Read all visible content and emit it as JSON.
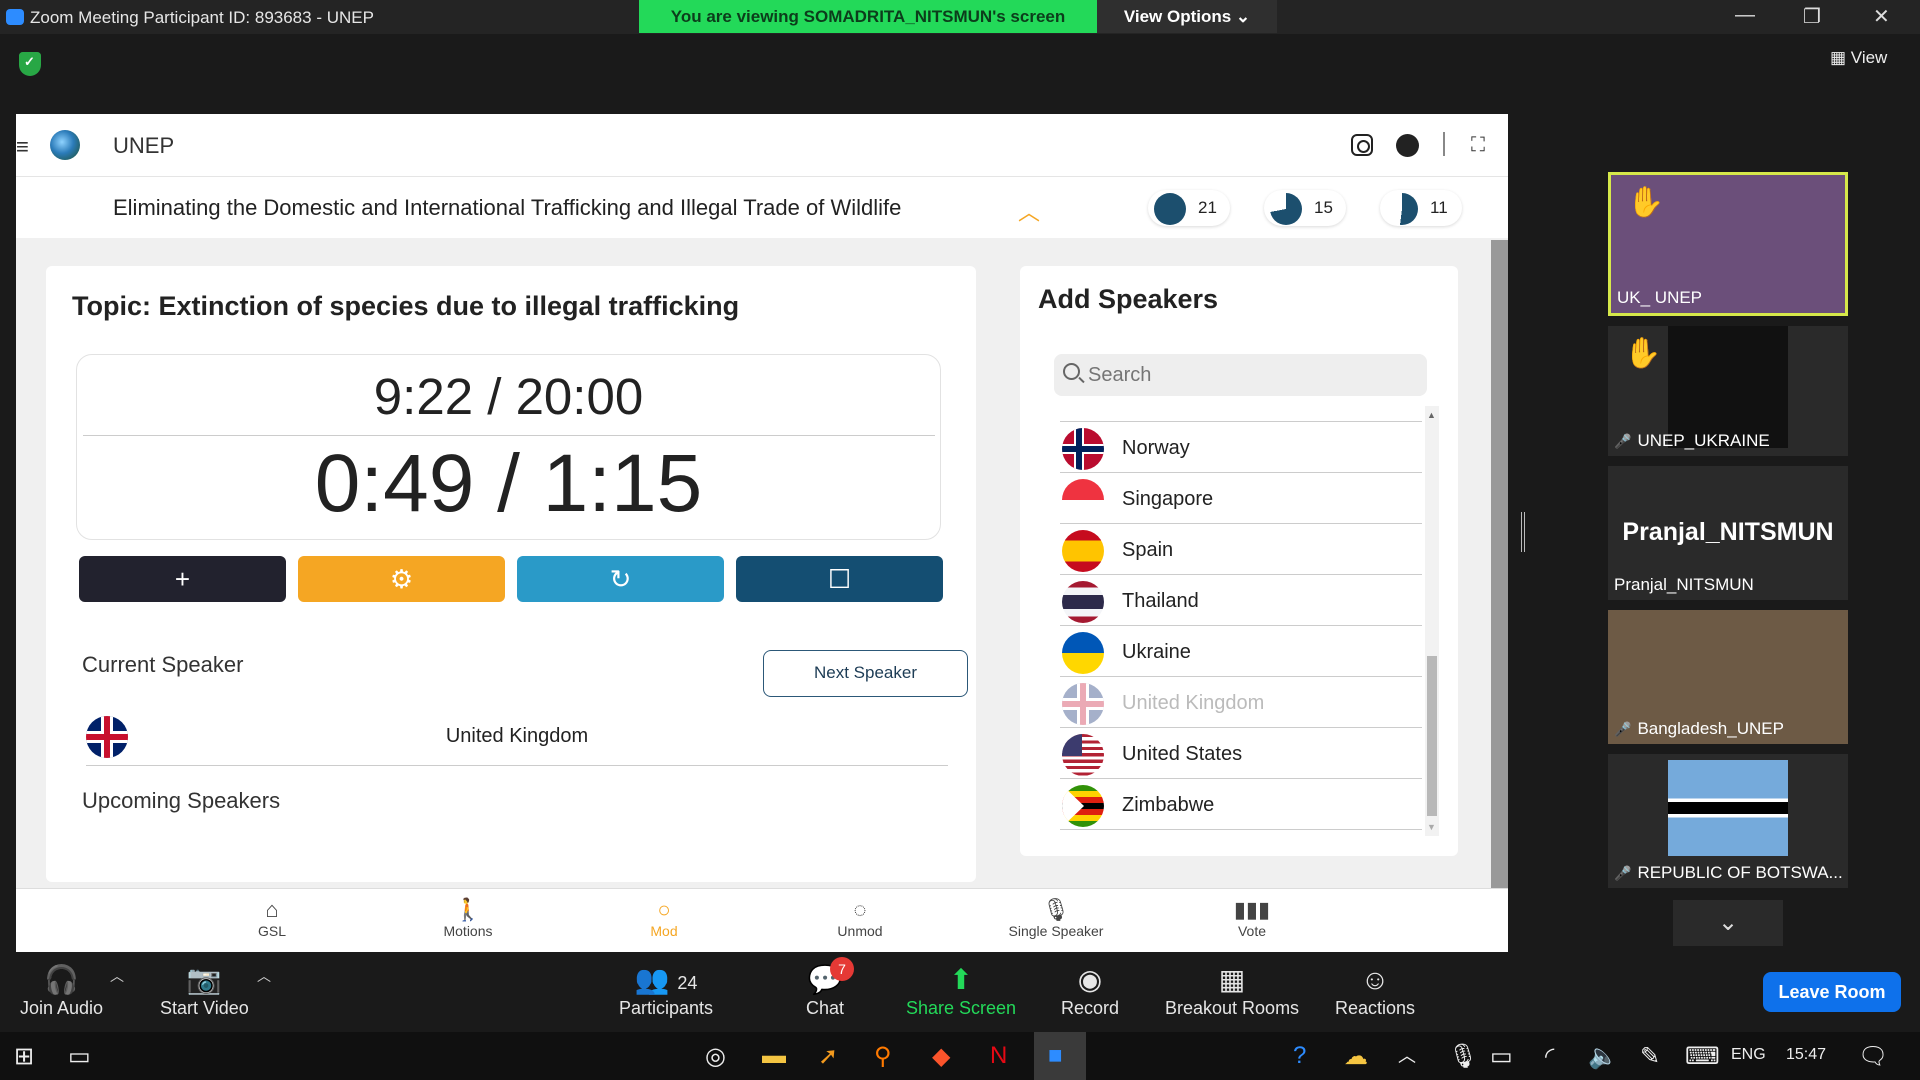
{
  "window": {
    "title": "Zoom Meeting Participant ID: 893683 - UNEP",
    "viewing_banner": "You are viewing SOMADRITA_NITSMUN's screen",
    "view_options": "View Options ⌄",
    "view_label": "View"
  },
  "app": {
    "name": "UNEP",
    "agenda": "Eliminating the Domestic and International Trafficking and Illegal Trade of Wildlife",
    "votes": [
      {
        "count": "21",
        "fraction": 1.0
      },
      {
        "count": "15",
        "fraction": 0.72
      },
      {
        "count": "11",
        "fraction": 0.52
      }
    ]
  },
  "speaker_panel": {
    "topic": "Topic: Extinction of species due to illegal trafficking",
    "total_timer": "9:22 / 20:00",
    "speaker_timer": "0:49 / 1:15",
    "buttons": [
      "+",
      "⚙",
      "↻",
      "☐"
    ],
    "current_speaker_label": "Current Speaker",
    "next_speaker_label": "Next Speaker",
    "current_speaker": "United Kingdom",
    "upcoming_label": "Upcoming Speakers"
  },
  "add_speakers": {
    "heading": "Add Speakers",
    "search_placeholder": "Search",
    "countries": [
      {
        "name": "Norway",
        "disabled": false
      },
      {
        "name": "Singapore",
        "disabled": false
      },
      {
        "name": "Spain",
        "disabled": false
      },
      {
        "name": "Thailand",
        "disabled": false
      },
      {
        "name": "Ukraine",
        "disabled": false
      },
      {
        "name": "United Kingdom",
        "disabled": true
      },
      {
        "name": "United States",
        "disabled": false
      },
      {
        "name": "Zimbabwe",
        "disabled": false
      }
    ]
  },
  "bottom_nav": [
    {
      "label": "GSL",
      "icon": "home-icon"
    },
    {
      "label": "Motions",
      "icon": "walk-icon"
    },
    {
      "label": "Mod",
      "icon": "chat-bubble-icon",
      "active": true
    },
    {
      "label": "Unmod",
      "icon": "chat-bubble-outline-icon"
    },
    {
      "label": "Single Speaker",
      "icon": "microphone-icon"
    },
    {
      "label": "Vote",
      "icon": "bar-chart-icon"
    }
  ],
  "gallery": {
    "tiles": [
      {
        "name": "UK_ UNEP"
      },
      {
        "name": "UNEP_UKRAINE"
      },
      {
        "name": "Pranjal_NITSMUN",
        "display": "Pranjal_NITSMUN"
      },
      {
        "name": "Bangladesh_UNEP"
      },
      {
        "name": "REPUBLIC OF BOTSWA..."
      }
    ]
  },
  "toolbar": {
    "join_audio": "Join Audio",
    "start_video": "Start Video",
    "participants": "Participants",
    "participants_count": "24",
    "chat": "Chat",
    "chat_badge": "7",
    "share_screen": "Share Screen",
    "record": "Record",
    "breakout": "Breakout Rooms",
    "reactions": "Reactions",
    "leave": "Leave Room"
  },
  "taskbar": {
    "lang": "ENG",
    "time": "15:47"
  },
  "colors": {
    "dark_btn": "#22222e",
    "orange_btn": "#f5a623",
    "blue_btn": "#2a9ac8",
    "navy_btn": "#144e72",
    "zoom_green": "#23d959",
    "zoom_blue": "#0e71eb"
  }
}
